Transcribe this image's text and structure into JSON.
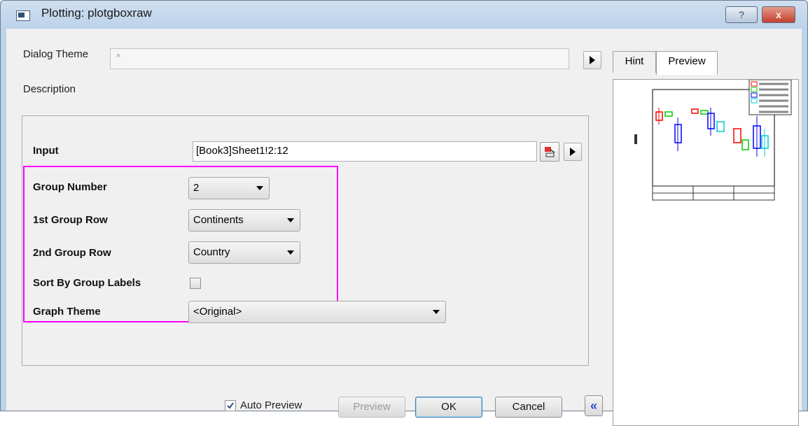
{
  "window": {
    "title": "Plotting: plotgboxraw",
    "help_label": "?",
    "close_label": "x"
  },
  "dialog_theme": {
    "label": "Dialog Theme",
    "value": "×"
  },
  "description": {
    "label": "Description"
  },
  "form": {
    "input": {
      "label": "Input",
      "value": "[Book3]Sheet1!2:12"
    },
    "group_number": {
      "label": "Group Number",
      "value": "2"
    },
    "first_group_row": {
      "label": "1st Group Row",
      "value": "Continents"
    },
    "second_group_row": {
      "label": "2nd Group Row",
      "value": "Country"
    },
    "sort_by_group_labels": {
      "label": "Sort By Group Labels",
      "checked": false
    },
    "graph_theme": {
      "label": "Graph Theme",
      "value": "<Original>"
    }
  },
  "buttons": {
    "auto_preview": {
      "label": "Auto Preview",
      "checked": true
    },
    "preview": "Preview",
    "ok": "OK",
    "cancel": "Cancel",
    "collapse": "«"
  },
  "side_tabs": [
    {
      "label": "Hint",
      "active": false
    },
    {
      "label": "Preview",
      "active": true
    }
  ],
  "colors": {
    "highlight": "#ff00ff",
    "series": [
      "#ff0000",
      "#00cc00",
      "#0000ff",
      "#00cccc"
    ]
  }
}
